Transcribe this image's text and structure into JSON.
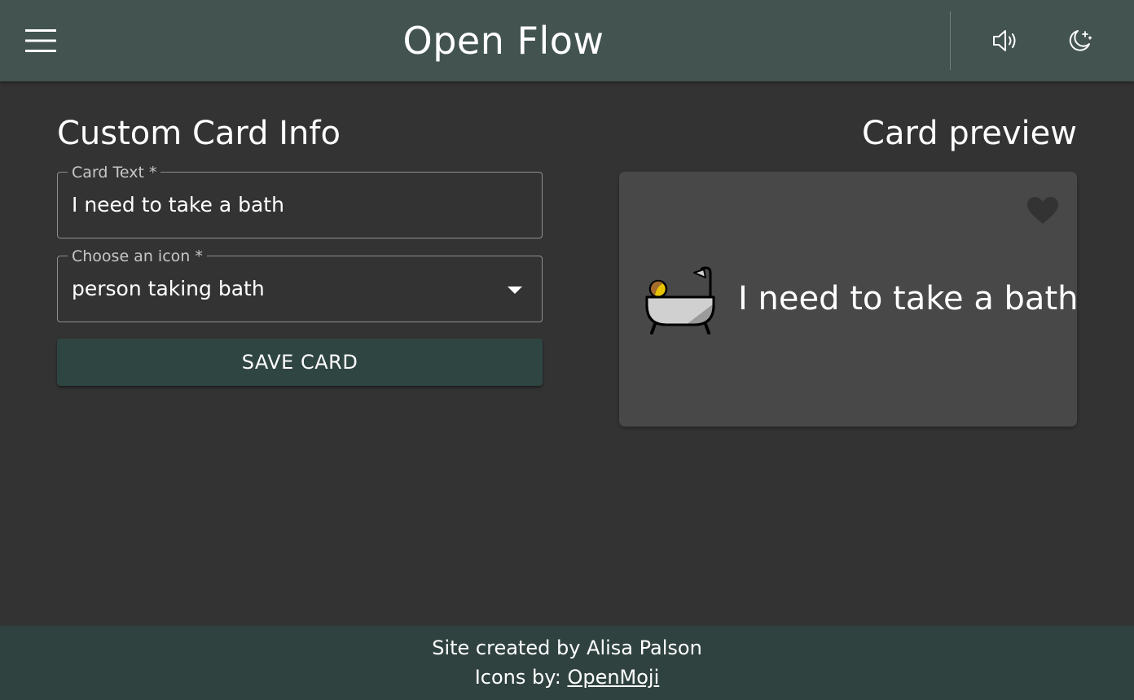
{
  "header": {
    "title": "Open Flow",
    "menu_icon": "hamburger-menu-icon",
    "sound_icon": "speaker-icon",
    "theme_icon": "moon-stars-icon",
    "background": "#425350"
  },
  "form": {
    "title": "Custom Card Info",
    "card_text": {
      "label": "Card Text *",
      "value": "I need to take a bath"
    },
    "icon_select": {
      "label": "Choose an icon *",
      "value": "person taking bath"
    },
    "save_label": "SAVE CARD",
    "save_color": "#2f4542"
  },
  "preview": {
    "title": "Card preview",
    "card_text": "I need to take a bath",
    "icon": "person-taking-bath-icon",
    "favorite_icon": "heart-icon"
  },
  "footer": {
    "credit": "Site created by Alisa Palson",
    "icons_prefix": "Icons by:",
    "icons_link": "OpenMoji",
    "background": "#2f4240"
  }
}
